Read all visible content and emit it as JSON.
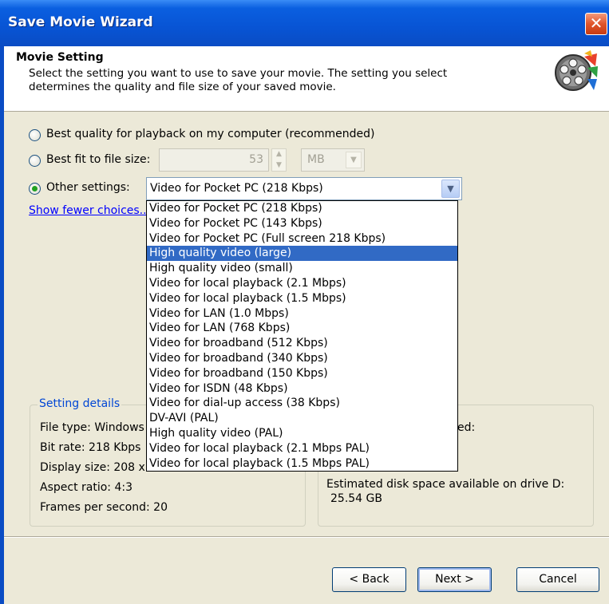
{
  "window": {
    "title": "Save Movie Wizard",
    "close_glyph": "✕"
  },
  "header": {
    "title": "Movie Setting",
    "description": "Select the setting you want to use to save your movie. The setting you select determines the quality and file size of your saved movie.",
    "icon": "film-reel-icon"
  },
  "options": {
    "best_quality_label": "Best quality for playback on my computer (recommended)",
    "best_fit_label": "Best fit to file size:",
    "best_fit_value": "53",
    "best_fit_unit": "MB",
    "other_label": "Other settings:",
    "other_selected": "Video for Pocket PC (218 Kbps)",
    "selected_option": "other"
  },
  "show_fewer_link": "Show fewer choices...",
  "dropdown": {
    "highlighted": "High quality video (large)",
    "items": [
      "Video for Pocket PC (218 Kbps)",
      "Video for Pocket PC (143 Kbps)",
      "Video for Pocket PC (Full screen 218 Kbps)",
      "High quality video (large)",
      "High quality video (small)",
      "Video for local playback (2.1 Mbps)",
      "Video for local playback (1.5 Mbps)",
      "Video for LAN (1.0 Mbps)",
      "Video for LAN (768 Kbps)",
      "Video for broadband (512 Kbps)",
      "Video for broadband (340 Kbps)",
      "Video for broadband (150 Kbps)",
      "Video for ISDN (48 Kbps)",
      "Video for dial-up access (38 Kbps)",
      "DV-AVI (PAL)",
      "High quality video (PAL)",
      "Video for local playback (2.1 Mbps PAL)",
      "Video for local playback (1.5 Mbps PAL)"
    ]
  },
  "setting_details": {
    "title": "Setting details",
    "file_type": "File type: Windows",
    "bit_rate": "Bit rate: 218 Kbps",
    "display_size": "Display size: 208 x",
    "aspect_ratio": "Aspect ratio: 4:3",
    "fps": "Frames per second: 20"
  },
  "file_size": {
    "partial_label": "ed:",
    "disk_space_label": "Estimated disk space available on drive D:",
    "disk_space_value": "25.54 GB"
  },
  "buttons": {
    "back": "< Back",
    "next": "Next >",
    "cancel": "Cancel"
  }
}
